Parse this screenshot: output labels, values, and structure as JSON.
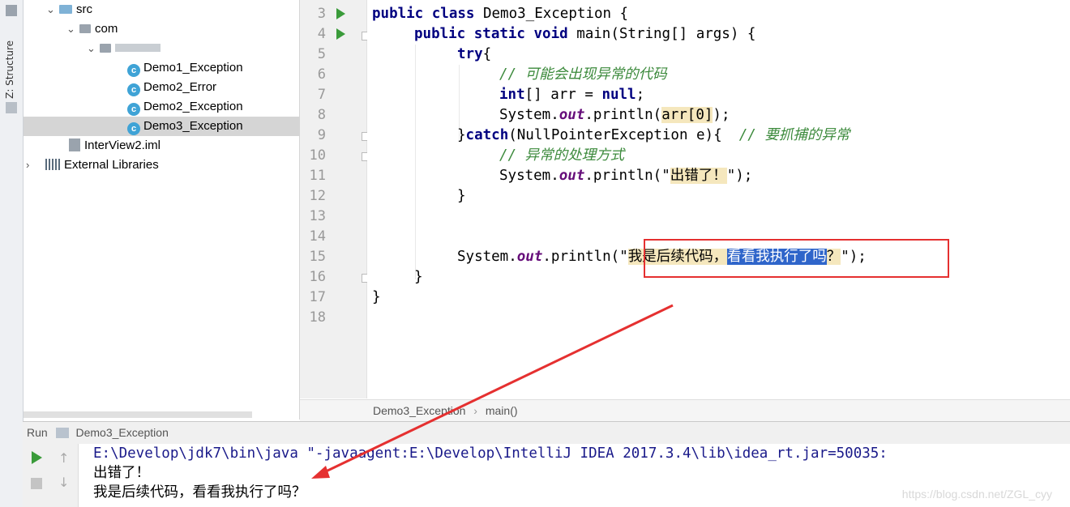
{
  "tool_strip": {
    "structure_label": "Z: Structure"
  },
  "tree": {
    "items": [
      {
        "label": "src",
        "icon": "folder-icon",
        "expanded": true
      },
      {
        "label": "com",
        "icon": "package-icon",
        "expanded": true
      },
      {
        "label": "",
        "icon": "package-icon",
        "expanded": true
      },
      {
        "label": "Demo1_Exception",
        "icon": "class-icon"
      },
      {
        "label": "Demo2_Error",
        "icon": "class-icon"
      },
      {
        "label": "Demo2_Exception",
        "icon": "class-icon"
      },
      {
        "label": "Demo3_Exception",
        "icon": "class-icon",
        "selected": true
      },
      {
        "label": "InterView2.iml",
        "icon": "module-file-icon"
      },
      {
        "label": "External Libraries",
        "icon": "library-icon",
        "expanded": false
      }
    ]
  },
  "editor": {
    "line_numbers": [
      "3",
      "4",
      "5",
      "6",
      "7",
      "8",
      "9",
      "10",
      "11",
      "12",
      "13",
      "14",
      "15",
      "16",
      "17",
      "18"
    ],
    "lines": {
      "l3": {
        "kw": "public class",
        "rest": " Demo3_Exception {"
      },
      "l4": {
        "kw": "public static void",
        "rest": " main(String[] args) {"
      },
      "l5": {
        "kw": "try",
        "rest": "{"
      },
      "l6": {
        "comment": "// 可能会出现异常的代码"
      },
      "l7": {
        "kw": "int",
        "mid": "[] arr = ",
        "kw2": "null",
        "end": ";"
      },
      "l8": {
        "pre": "System.",
        "fld": "out",
        "mid": ".println(",
        "hl": "arr[0]",
        "end": ");"
      },
      "l9": {
        "pre": "}",
        "kw": "catch",
        "mid": "(NullPointerException e){  ",
        "comment": "// 要抓捕的异常"
      },
      "l10": {
        "comment": "// 异常的处理方式"
      },
      "l11": {
        "pre": "System.",
        "fld": "out",
        "mid": ".println(\"",
        "hl": "出错了！",
        "end": "\");"
      },
      "l12": {
        "text": "}"
      },
      "l15": {
        "pre": "System.",
        "fld": "out",
        "mid": ".println(\"",
        "hl": "我是后续代码，",
        "sel": "看看我执行了吗",
        "hl2": "？",
        "end": "\");"
      },
      "l16": {
        "text": "}"
      },
      "l17": {
        "text": "}"
      }
    }
  },
  "breadcrumb": {
    "class": "Demo3_Exception",
    "sep": "›",
    "method": "main()"
  },
  "run": {
    "title": "Run",
    "config": "Demo3_Exception",
    "output": [
      "E:\\Develop\\jdk7\\bin\\java \"-javaagent:E:\\Develop\\IntelliJ IDEA 2017.3.4\\lib\\idea_rt.jar=50035:",
      "出错了！",
      "我是后续代码，看看我执行了吗？"
    ]
  },
  "watermark": "https://blog.csdn.net/ZGL_cyy",
  "colors": {
    "annotation": "#e53030",
    "keyword": "#000080",
    "comment": "#3c8a3c",
    "field": "#660e7a",
    "selection": "#2f65ca"
  }
}
